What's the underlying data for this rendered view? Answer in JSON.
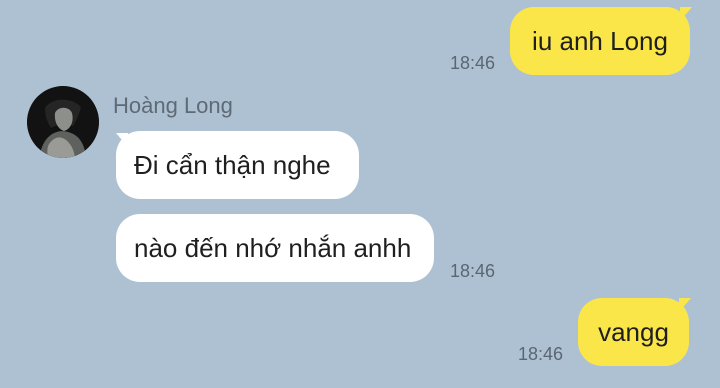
{
  "conversation": {
    "messages": [
      {
        "direction": "outgoing",
        "text": "iu anh Long",
        "time": "18:46"
      },
      {
        "direction": "incoming",
        "sender": "Hoàng Long",
        "text": "Đi cẩn thận nghe"
      },
      {
        "direction": "incoming",
        "text": "nào đến nhớ nhắn anhh",
        "time": "18:46"
      },
      {
        "direction": "outgoing",
        "text": "vangg",
        "time": "18:46"
      }
    ]
  },
  "contact": {
    "name": "Hoàng Long",
    "avatar_icon": "profile-photo"
  },
  "colors": {
    "background": "#aec1d3",
    "outgoing_bubble": "#fbe64a",
    "incoming_bubble": "#ffffff",
    "timestamp_text": "#5b6672"
  }
}
